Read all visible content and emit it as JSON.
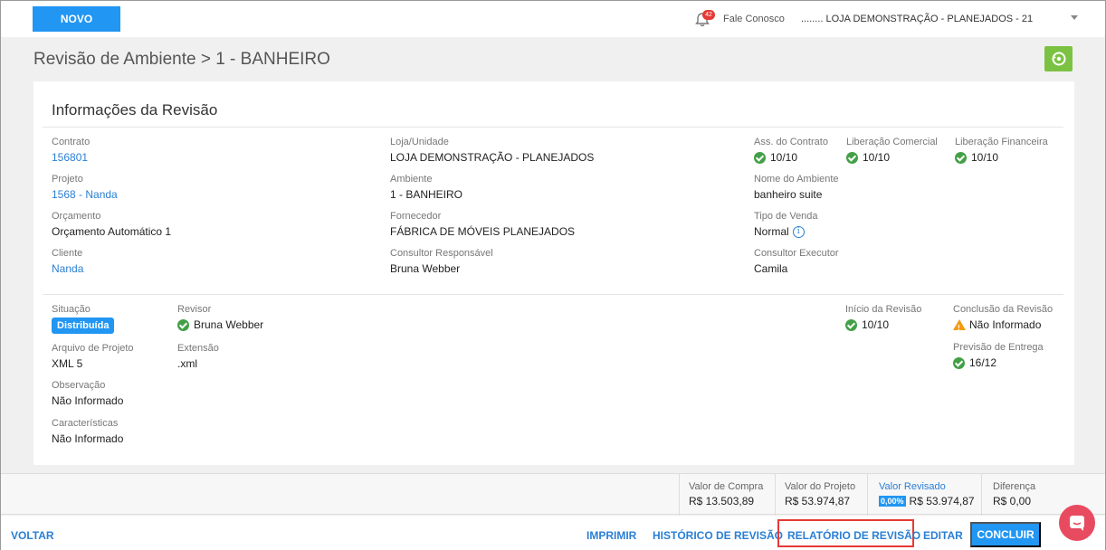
{
  "topbar": {
    "novo_label": "NOVO",
    "notifications_count": "42",
    "fale_conosco": "Fale Conosco",
    "store": "........ LOJA DEMONSTRAÇÃO - PLANEJADOS - 21"
  },
  "page_title": "Revisão de Ambiente > 1 - BANHEIRO",
  "card": {
    "title": "Informações da Revisão",
    "contrato": {
      "label": "Contrato",
      "value": "156801"
    },
    "projeto": {
      "label": "Projeto",
      "value": "1568 - Nanda"
    },
    "orcamento": {
      "label": "Orçamento",
      "value": "Orçamento Automático 1"
    },
    "cliente": {
      "label": "Cliente",
      "value": "Nanda"
    },
    "loja": {
      "label": "Loja/Unidade",
      "value": "LOJA DEMONSTRAÇÃO - PLANEJADOS"
    },
    "ambiente": {
      "label": "Ambiente",
      "value": "1 - BANHEIRO"
    },
    "fornecedor": {
      "label": "Fornecedor",
      "value": "FÁBRICA DE MÓVEIS PLANEJADOS"
    },
    "consultor_resp": {
      "label": "Consultor Responsável",
      "value": "Bruna Webber"
    },
    "ass_contrato": {
      "label": "Ass. do Contrato",
      "value": "10/10"
    },
    "lib_comercial": {
      "label": "Liberação Comercial",
      "value": "10/10"
    },
    "lib_financeira": {
      "label": "Liberação Financeira",
      "value": "10/10"
    },
    "nome_ambiente": {
      "label": "Nome do Ambiente",
      "value": "banheiro suite"
    },
    "tipo_venda": {
      "label": "Tipo de Venda",
      "value": "Normal"
    },
    "consultor_exec": {
      "label": "Consultor Executor",
      "value": "Camila"
    },
    "situacao": {
      "label": "Situação",
      "value": "Distribuída"
    },
    "revisor": {
      "label": "Revisor",
      "value": "Bruna Webber"
    },
    "arquivo": {
      "label": "Arquivo de Projeto",
      "value": "XML 5"
    },
    "extensao": {
      "label": "Extensão",
      "value": ".xml"
    },
    "observacao": {
      "label": "Observação",
      "value": "Não Informado"
    },
    "caracteristicas": {
      "label": "Características",
      "value": "Não Informado"
    },
    "inicio_revisao": {
      "label": "Início da Revisão",
      "value": "10/10"
    },
    "conclusao_revisao": {
      "label": "Conclusão da Revisão",
      "value": "Não Informado"
    },
    "previsao_entrega": {
      "label": "Previsão de Entrega",
      "value": "16/12"
    }
  },
  "totals": {
    "valor_compra": {
      "label": "Valor de Compra",
      "value": "R$ 13.503,89"
    },
    "valor_projeto": {
      "label": "Valor do Projeto",
      "value": "R$ 53.974,87"
    },
    "valor_revisado": {
      "label": "Valor Revisado",
      "percent": "0,00%",
      "value": "R$ 53.974,87"
    },
    "diferenca": {
      "label": "Diferença",
      "value": "R$ 0,00"
    }
  },
  "actions": {
    "voltar": "VOLTAR",
    "imprimir": "IMPRIMIR",
    "historico": "HISTÓRICO DE REVISÃO",
    "relatorio": "RELATÓRIO DE REVISÃO",
    "editar": "EDITAR",
    "concluir": "CONCLUIR"
  },
  "colors": {
    "primary": "#2196f3",
    "success": "#43a047",
    "warning": "#f39c12",
    "highlight": "#e53935",
    "chat": "#e84a5f"
  }
}
